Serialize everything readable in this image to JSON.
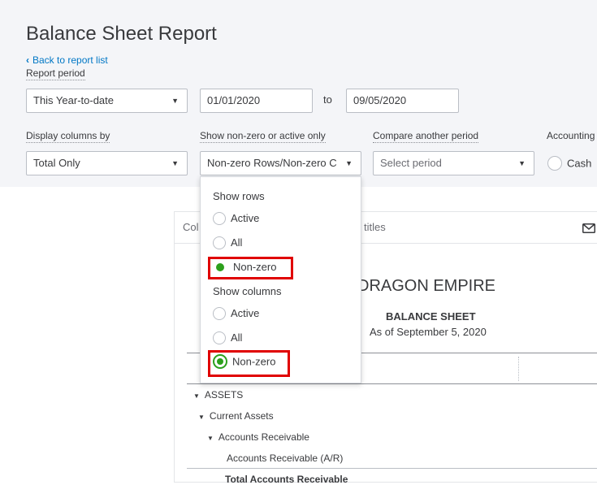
{
  "page": {
    "title": "Balance Sheet Report",
    "back_link": "Back to report list"
  },
  "report_period": {
    "label": "Report period",
    "selected": "This Year-to-date",
    "from_date": "01/01/2020",
    "to_label": "to",
    "to_date": "09/05/2020"
  },
  "display_columns": {
    "label": "Display columns by",
    "selected": "Total Only"
  },
  "non_zero": {
    "label": "Show non-zero or active only",
    "selected": "Non-zero Rows/Non-zero C"
  },
  "compare": {
    "label": "Compare another period",
    "placeholder": "Select period"
  },
  "accounting": {
    "label": "Accounting",
    "cash_option": "Cash"
  },
  "popup": {
    "rows_heading": "Show rows",
    "rows_options": [
      "Active",
      "All",
      "Non-zero"
    ],
    "rows_selected": "Non-zero",
    "columns_heading": "Show columns",
    "columns_options": [
      "Active",
      "All",
      "Non-zero"
    ],
    "columns_selected": "Non-zero"
  },
  "report": {
    "toolbar_left": "Col",
    "toolbar_mid": "titles",
    "company": "DRAGON EMPIRE",
    "sheet_title": "BALANCE SHEET",
    "as_of": "As of September 5, 2020",
    "rows": [
      {
        "label": "ASSETS"
      },
      {
        "label": "Current Assets"
      },
      {
        "label": "Accounts Receivable"
      },
      {
        "label": "Accounts Receivable (A/R)"
      },
      {
        "label": "Total Accounts Receivable"
      }
    ]
  },
  "colors": {
    "accent_green": "#2ca01c",
    "link_blue": "#0077c5",
    "highlight_red": "#e00000"
  }
}
